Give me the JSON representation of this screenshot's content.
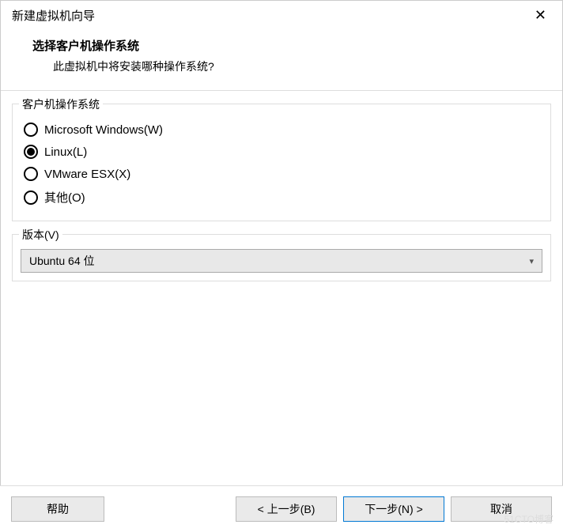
{
  "window": {
    "title": "新建虚拟机向导"
  },
  "header": {
    "title": "选择客户机操作系统",
    "subtitle": "此虚拟机中将安装哪种操作系统?"
  },
  "osGroup": {
    "legend": "客户机操作系统",
    "options": [
      {
        "label": "Microsoft Windows(W)",
        "selected": false
      },
      {
        "label": "Linux(L)",
        "selected": true
      },
      {
        "label": "VMware ESX(X)",
        "selected": false
      },
      {
        "label": "其他(O)",
        "selected": false
      }
    ]
  },
  "versionGroup": {
    "legend": "版本(V)",
    "selected": "Ubuntu 64 位"
  },
  "buttons": {
    "help": "帮助",
    "back": "< 上一步(B)",
    "next": "下一步(N) >",
    "cancel": "取消"
  },
  "watermark": "51CTO博客"
}
